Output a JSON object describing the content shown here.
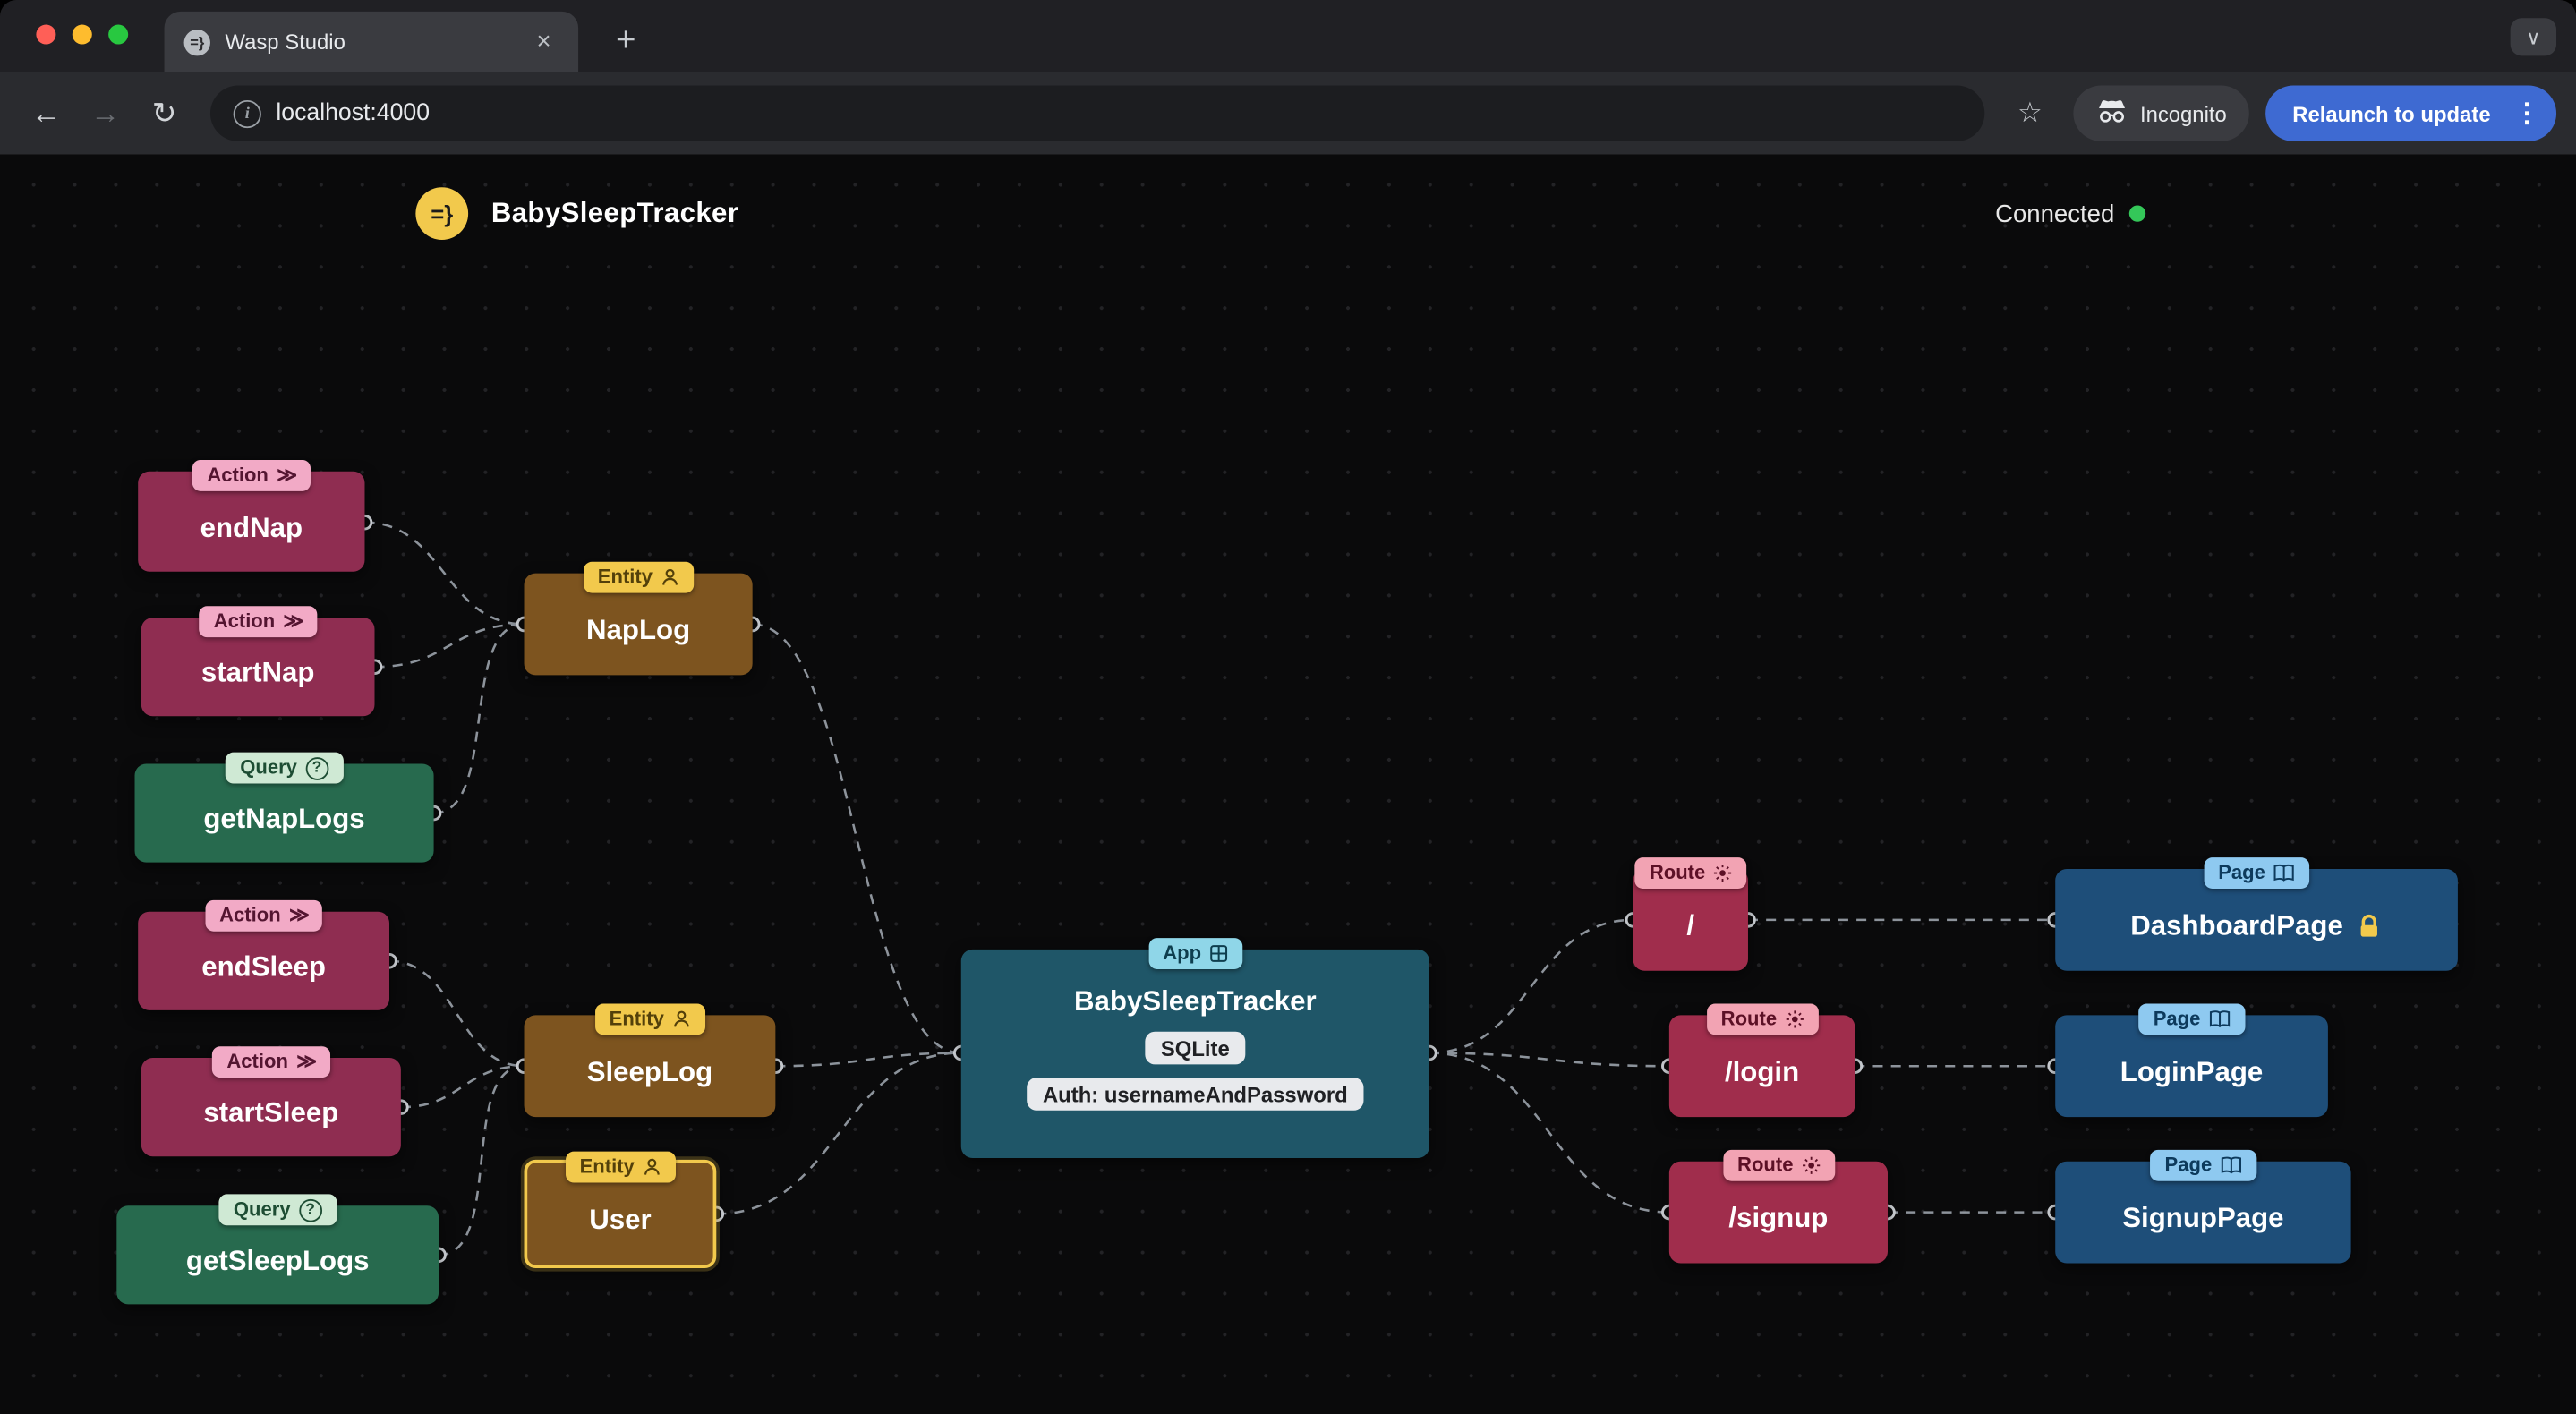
{
  "browser": {
    "tab_title": "Wasp Studio",
    "url": "localhost:4000",
    "incognito_label": "Incognito",
    "relaunch_label": "Relaunch to update"
  },
  "studio": {
    "logo_glyph": "=}",
    "app_title": "BabySleepTracker",
    "status": "Connected"
  },
  "nodes": {
    "endNap": {
      "badge": "Action",
      "title": "endNap"
    },
    "startNap": {
      "badge": "Action",
      "title": "startNap"
    },
    "getNapLogs": {
      "badge": "Query",
      "title": "getNapLogs"
    },
    "endSleep": {
      "badge": "Action",
      "title": "endSleep"
    },
    "startSleep": {
      "badge": "Action",
      "title": "startSleep"
    },
    "getSleepLogs": {
      "badge": "Query",
      "title": "getSleepLogs"
    },
    "napLog": {
      "badge": "Entity",
      "title": "NapLog"
    },
    "sleepLog": {
      "badge": "Entity",
      "title": "SleepLog"
    },
    "user": {
      "badge": "Entity",
      "title": "User"
    },
    "app": {
      "badge": "App",
      "title": "BabySleepTracker",
      "database": "SQLite",
      "auth": "Auth: usernameAndPassword"
    },
    "routeRoot": {
      "badge": "Route",
      "title": "/"
    },
    "routeLogin": {
      "badge": "Route",
      "title": "/login"
    },
    "routeSignup": {
      "badge": "Route",
      "title": "/signup"
    },
    "pageDashboard": {
      "badge": "Page",
      "title": "DashboardPage"
    },
    "pageLogin": {
      "badge": "Page",
      "title": "LoginPage"
    },
    "pageSignup": {
      "badge": "Page",
      "title": "SignupPage"
    }
  },
  "colors": {
    "action_node": "#8f2d51",
    "action_badge": "#f2aac6",
    "query_node": "#276a4e",
    "query_badge": "#cfe9d4",
    "entity_node": "#7d541f",
    "entity_badge": "#f2c94c",
    "app_node": "#1f5668",
    "app_badge": "#8fd6e8",
    "route_node": "#a02d4c",
    "route_badge": "#f2a3b3",
    "page_node": "#1e4e79",
    "page_badge": "#8ec9f0",
    "selected_border": "#f2c94c",
    "connected_dot": "#34c759",
    "relaunch_button": "#3e6ad2",
    "lock_icon": "#f2c94c"
  }
}
